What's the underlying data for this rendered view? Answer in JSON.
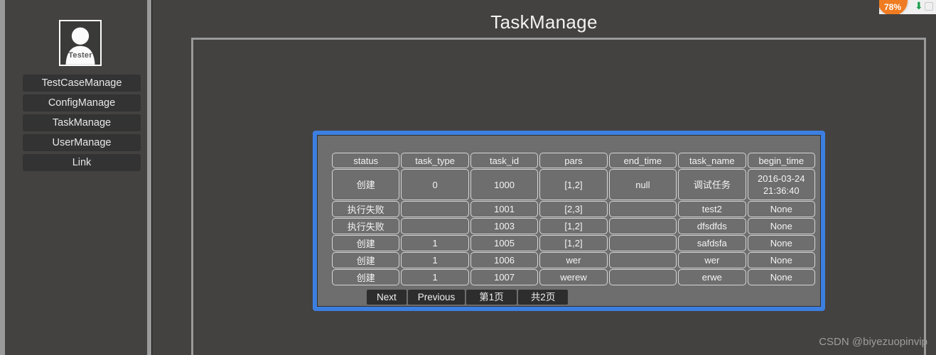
{
  "app": {
    "title": "TaskManage",
    "watermark": "CSDN @biyezuopinvip"
  },
  "colors": {
    "background": "#434241",
    "outer": "#9a9a9a",
    "accent_blue": "#3d7fe0",
    "table_bg": "#6e6e6e",
    "button_dark": "#333333",
    "badge_orange": "#ef7c22",
    "download_green": "#1a9e4b"
  },
  "sidebar": {
    "avatar": {
      "label": "Tester",
      "icon": "user-avatar-icon"
    },
    "items": [
      {
        "label": "TestCaseManage"
      },
      {
        "label": "ConfigManage"
      },
      {
        "label": "TaskManage"
      },
      {
        "label": "UserManage"
      },
      {
        "label": "Link"
      }
    ]
  },
  "table": {
    "columns": [
      "status",
      "task_type",
      "task_id",
      "pars",
      "end_time",
      "task_name",
      "begin_time"
    ],
    "rows": [
      [
        "创建",
        "0",
        "1000",
        "[1,2]",
        "null",
        "调试任务",
        "2016-03-24 21:36:40"
      ],
      [
        "执行失败",
        "",
        "1001",
        "[2,3]",
        "",
        "test2",
        "None"
      ],
      [
        "执行失败",
        "",
        "1003",
        "[1,2]",
        "",
        "dfsdfds",
        "None"
      ],
      [
        "创建",
        "1",
        "1005",
        "[1,2]",
        "",
        "safdsfa",
        "None"
      ],
      [
        "创建",
        "1",
        "1006",
        "wer",
        "",
        "wer",
        "None"
      ],
      [
        "创建",
        "1",
        "1007",
        "werew",
        "",
        "erwe",
        "None"
      ]
    ]
  },
  "pagination": {
    "next": "Next",
    "previous": "Previous",
    "current_page": "第1页",
    "total_pages": "共2页"
  },
  "browser_chrome": {
    "download_badge": "78%",
    "download_arrow": "⬇"
  }
}
